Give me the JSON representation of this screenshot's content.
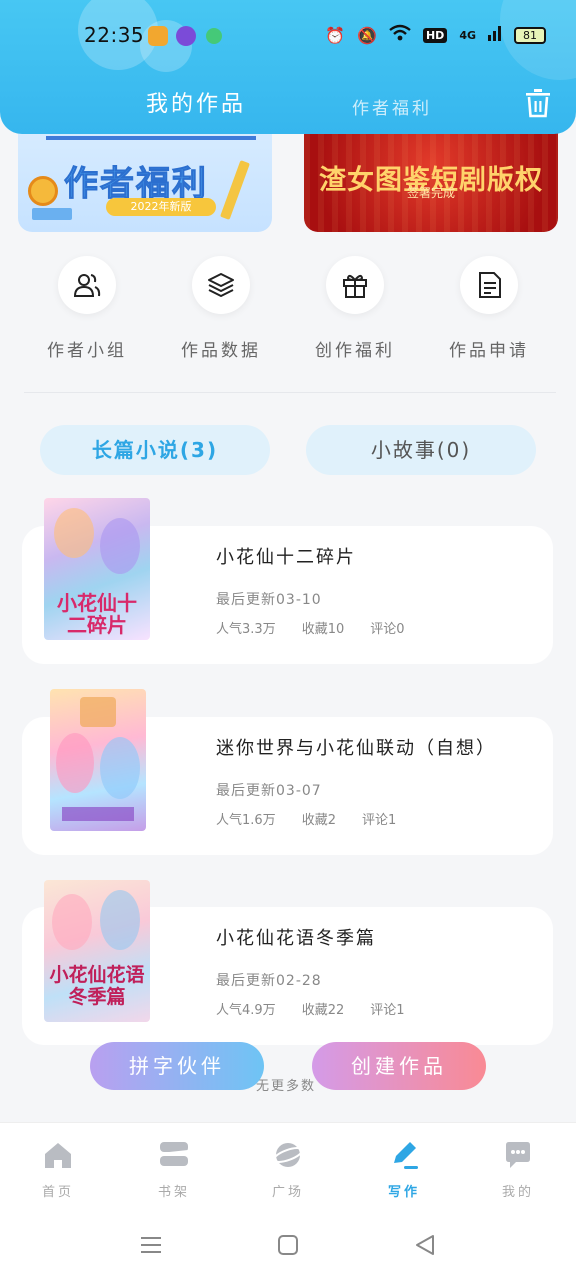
{
  "status_bar": {
    "time": "22:35",
    "battery": "81",
    "hd": "HD",
    "network": "4G"
  },
  "header": {
    "tab_mine": "我的作品",
    "tab_welfare": "作者福利"
  },
  "banners": {
    "left": {
      "title": "作者福利",
      "pill": "2022年新版"
    },
    "right": {
      "title": "渣女图鉴短剧版权",
      "subtitle": "签署完成"
    }
  },
  "quick_menu": [
    {
      "label": "作者小组",
      "icon": "users-icon"
    },
    {
      "label": "作品数据",
      "icon": "layers-icon"
    },
    {
      "label": "创作福利",
      "icon": "gift-icon"
    },
    {
      "label": "作品申请",
      "icon": "document-icon"
    }
  ],
  "category_tabs": {
    "novel": "长篇小说(3)",
    "story": "小故事(0)"
  },
  "works": [
    {
      "title": "小花仙十二碎片",
      "updated": "最后更新03-10",
      "popularity": "人气3.3万",
      "favorites": "收藏10",
      "comments": "评论0",
      "cover_text": "小花仙十二碎片"
    },
    {
      "title": "迷你世界与小花仙联动（自想）",
      "updated": "最后更新03-07",
      "popularity": "人气1.6万",
      "favorites": "收藏2",
      "comments": "评论1",
      "cover_text": ""
    },
    {
      "title": "小花仙花语冬季篇",
      "updated": "最后更新02-28",
      "popularity": "人气4.9万",
      "favorites": "收藏22",
      "comments": "评论1",
      "cover_text": "小花仙花语冬季篇"
    }
  ],
  "footer": {
    "no_more": "无更多数",
    "partner_button": "拼字伙伴",
    "create_button": "创建作品"
  },
  "bottom_nav": [
    {
      "label": "首页",
      "icon": "home-icon",
      "active": false
    },
    {
      "label": "书架",
      "icon": "bookshelf-icon",
      "active": false
    },
    {
      "label": "广场",
      "icon": "planet-icon",
      "active": false
    },
    {
      "label": "写作",
      "icon": "pen-icon",
      "active": true
    },
    {
      "label": "我的",
      "icon": "chat-icon",
      "active": false
    }
  ],
  "colors": {
    "header": "#3bbbf0",
    "accent": "#2ea6e4",
    "tab_bg": "#e0f1fb"
  }
}
